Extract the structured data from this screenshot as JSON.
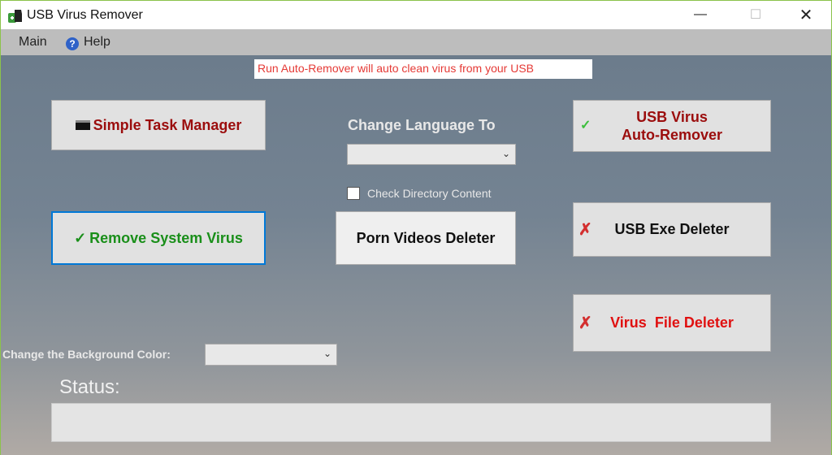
{
  "window": {
    "title": "USB Virus Remover",
    "minimize": "—",
    "maximize": "☐",
    "close": "✕"
  },
  "menu": {
    "main": "Main",
    "help": "Help"
  },
  "notice": "Run Auto-Remover will auto clean virus from your USB",
  "buttons": {
    "task_manager": "Simple Task Manager",
    "remove_system_virus": "Remove System Virus",
    "porn_deleter": "Porn Videos Deleter",
    "auto_remover_line1": "USB Virus",
    "auto_remover_line2": "Auto-Remover",
    "exe_deleter": "USB Exe Deleter",
    "virus_file_deleter": "Virus  File Deleter"
  },
  "language": {
    "label": "Change Language To",
    "value": ""
  },
  "check_directory": {
    "label": "Check Directory Content",
    "checked": false
  },
  "background_color": {
    "label": "Change the Background Color:",
    "value": ""
  },
  "status": {
    "label": "Status:",
    "value": ""
  },
  "colors": {
    "dark_red": "#9b0d0d",
    "red": "#e01010",
    "green": "#1a8f1a",
    "focus_border": "#0078d7"
  }
}
